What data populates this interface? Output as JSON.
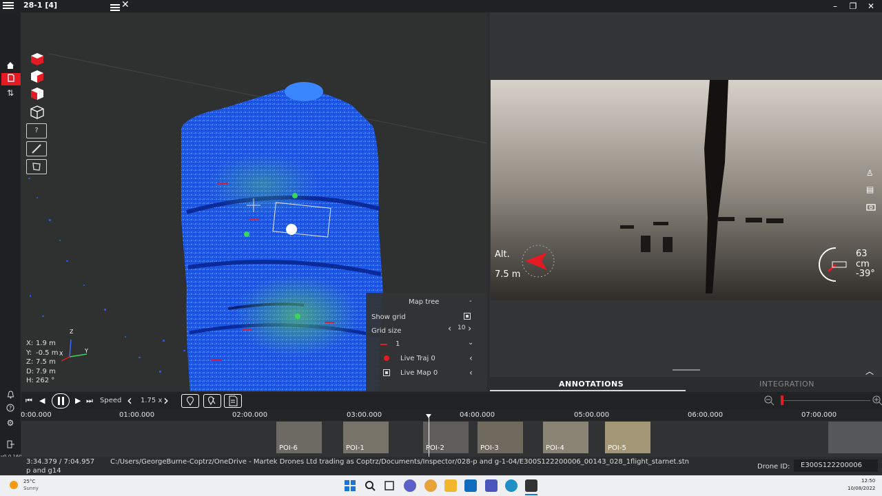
{
  "window": {
    "title": "28-1 [4]"
  },
  "viewport": {
    "coords": [
      {
        "label": "X:",
        "value": "1.9 m"
      },
      {
        "label": "Y:",
        "value": "-0.5 m"
      },
      {
        "label": "Z:",
        "value": "7.5 m"
      },
      {
        "label": "D:",
        "value": "7.9 m"
      },
      {
        "label": "H:",
        "value": "262 °"
      }
    ],
    "axis_labels": {
      "z": "Z",
      "x": "X",
      "y": "Y"
    },
    "help_label": "?"
  },
  "maptree": {
    "title": "Map tree",
    "collapse": "-",
    "show_grid": "Show grid",
    "grid_size_label": "Grid size",
    "grid_size_value": "10",
    "layer_value": "1",
    "live_traj": "Live Traj 0",
    "live_map": "Live Map 0"
  },
  "video": {
    "alt_label": "Alt.",
    "alt_value": "7.5 m",
    "distance": "63 cm",
    "angle": "-39°"
  },
  "tabs": {
    "annotations": "ANNOTATIONS",
    "integration": "INTEGRATION"
  },
  "playbar": {
    "speed_label": "Speed",
    "speed_value": "1.75 x"
  },
  "timeline": {
    "ticks": [
      "0:00.000",
      "01:00.000",
      "02:00.000",
      "03:00.000",
      "04:00.000",
      "05:00.000",
      "06:00.000",
      "07:00.000"
    ],
    "pois": [
      "POI-6",
      "POI-1",
      "POI-2",
      "POI-3",
      "POI-4",
      "POI-5"
    ]
  },
  "status": {
    "time": "3:34.379 / 7:04.957",
    "path": "C:/Users/GeorgeBurne-Coptrz/OneDrive - Martek Drones Ltd trading as Coptrz/Documents/Inspector/028-p and g-1-04/E300S122200006_00143_028_1flight_starnet.stn",
    "path_cont": "p and g14",
    "drone_label": "Drone ID:",
    "drone_id": "E300S122200006",
    "version": "v0.0.160"
  },
  "taskbar": {
    "temp": "25°C",
    "weather": "Sunny",
    "clock": "12:50",
    "date": "10/08/2022"
  },
  "colors": {
    "accent": "#e31b23",
    "pointcloud": "#1a4ff0"
  }
}
